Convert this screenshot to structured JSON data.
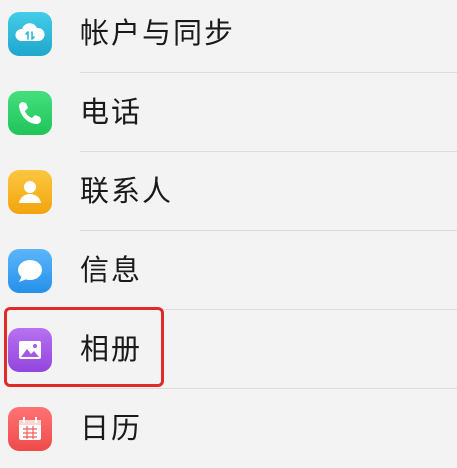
{
  "settings": {
    "items": [
      {
        "label": "帐户与同步",
        "icon": "cloud-sync-icon",
        "color": "#2fb8d8"
      },
      {
        "label": "电话",
        "icon": "phone-icon",
        "color": "#2ed16a"
      },
      {
        "label": "联系人",
        "icon": "contacts-icon",
        "color": "#f7b21f"
      },
      {
        "label": "信息",
        "icon": "message-icon",
        "color": "#3a9ff2"
      },
      {
        "label": "相册",
        "icon": "gallery-icon",
        "color": "#a35be6"
      },
      {
        "label": "日历",
        "icon": "calendar-icon",
        "color": "#f25a5a"
      }
    ]
  },
  "highlight": {
    "color": "#e02a2a",
    "target": "相册"
  }
}
